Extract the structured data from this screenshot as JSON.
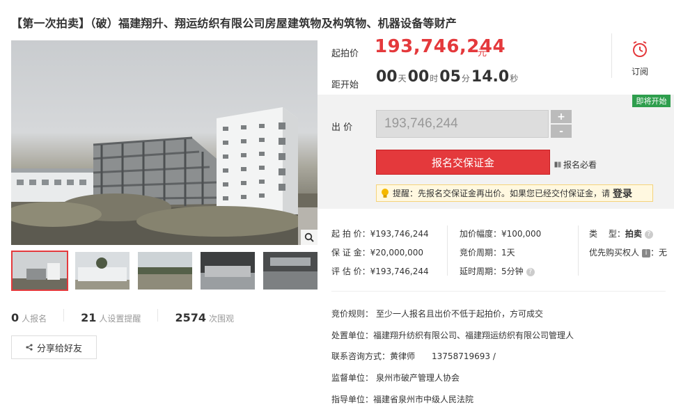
{
  "title": "【第一次拍卖】（破）福建翔升、翔运纺织有限公司房屋建筑物及构筑物、机器设备等财产",
  "price": {
    "start_label": "起拍价",
    "start_value": "193,746,244",
    "unit": "元"
  },
  "countdown": {
    "label": "距开始",
    "days": "00",
    "days_unit": "天",
    "hours": "00",
    "hours_unit": "时",
    "minutes": "05",
    "minutes_unit": "分",
    "seconds": "14.0",
    "seconds_unit": "秒"
  },
  "subscribe": {
    "label": "订阅",
    "icon": "alarm-clock-icon"
  },
  "status_tag": "即将开始",
  "bid": {
    "label": "出 价",
    "input_value": "193,746,244",
    "plus": "+",
    "minus": "-",
    "signup_button": "报名交保证金",
    "must_read": "报名必看"
  },
  "notice": {
    "prefix": "提醒：先报名交保证金再出价。如果您已经交付保证金，请",
    "login": "登录"
  },
  "info": {
    "col1": [
      {
        "k": "起 拍 价：",
        "v": "¥193,746,244"
      },
      {
        "k": "保 证 金：",
        "v": "¥20,000,000"
      },
      {
        "k": "评 估 价：",
        "v": "¥193,746,244"
      }
    ],
    "col2": [
      {
        "k": "加价幅度：",
        "v": "¥100,000"
      },
      {
        "k": "竞价周期：",
        "v": "1天"
      },
      {
        "k": "延时周期：",
        "v": "5分钟"
      }
    ],
    "col3": [
      {
        "k": "类　 型：",
        "v": "拍卖"
      },
      {
        "k": "优先购买权人",
        "v": "：无"
      }
    ]
  },
  "rules": [
    {
      "k": "竞价规则：",
      "v": "至少一人报名且出价不低于起拍价，方可成交"
    },
    {
      "k": "处置单位：",
      "v": "福建翔升纺织有限公司、福建翔运纺织有限公司管理人"
    },
    {
      "k": "联系咨询方式：",
      "v": "黄律师",
      "v2": "13758719693 /"
    },
    {
      "k": "监督单位：",
      "v": "泉州市破产管理人协会"
    },
    {
      "k": "指导单位：",
      "v": "福建省泉州市中级人民法院"
    }
  ],
  "stats": [
    {
      "num": "0",
      "label": "人报名"
    },
    {
      "num": "21",
      "label": "人设置提醒"
    },
    {
      "num": "2574",
      "label": "次围观"
    }
  ],
  "share": "分享给好友",
  "colors": {
    "accent": "#e4393c",
    "tag_green": "#2e9e4d",
    "notice_bg": "#fff8e0"
  }
}
